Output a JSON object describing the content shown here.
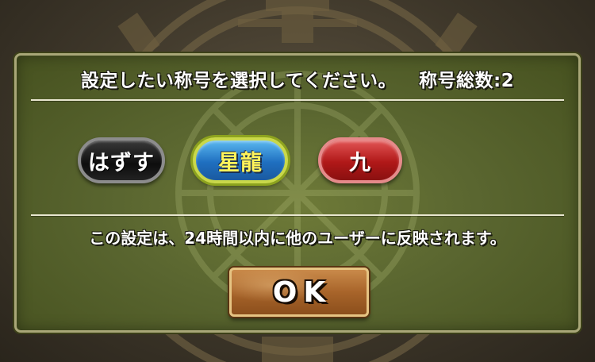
{
  "dialog": {
    "title": "設定したい称号を選択してください。",
    "count_label": "称号総数:2",
    "title_options": [
      {
        "label": "はずす",
        "color": "#111111"
      },
      {
        "label": "星龍",
        "color": "#1f6fc0"
      },
      {
        "label": "九",
        "color": "#b01818"
      }
    ],
    "notice": "この設定は、24時間以内に他のユーザーに反映されます。",
    "ok_label": "OK"
  },
  "colors": {
    "panel_green": "#5a6630",
    "background_brown": "#3e372a",
    "ok_orange": "#a8642a",
    "highlight_yellow": "#fff35a"
  }
}
